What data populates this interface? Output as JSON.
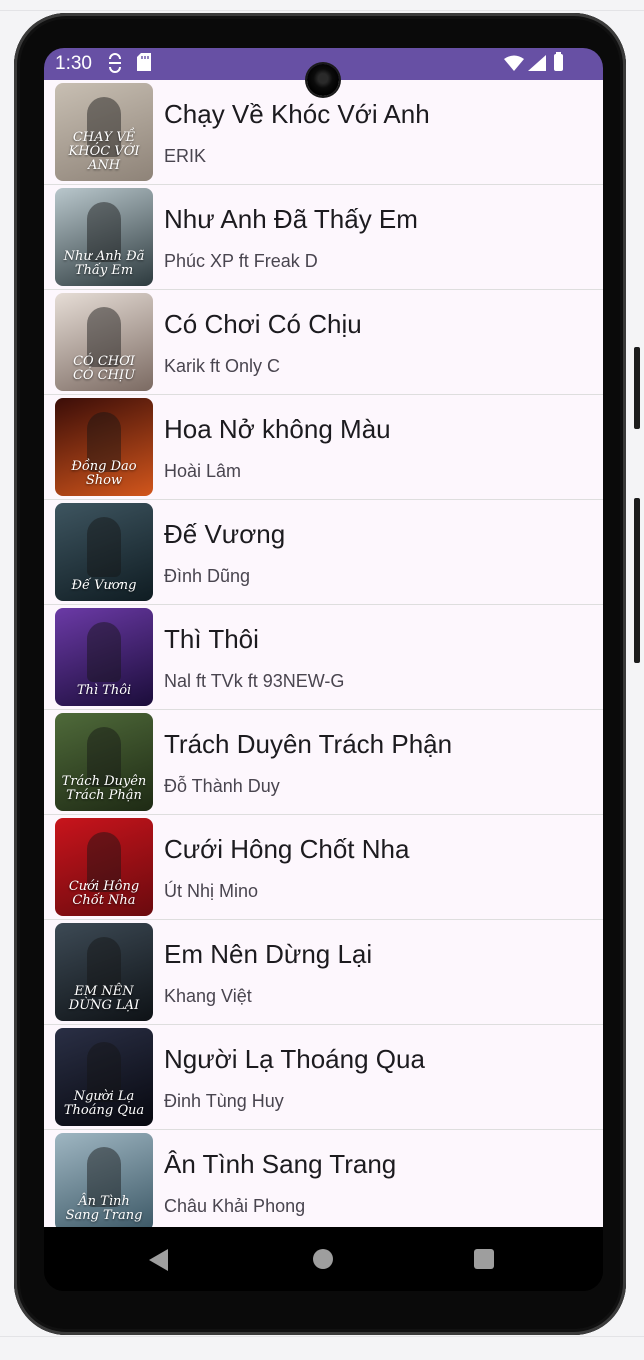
{
  "status_bar": {
    "time": "1:30",
    "icons": [
      "sync-icon",
      "sd-card-icon",
      "wifi-icon",
      "cell-signal-icon",
      "battery-icon"
    ]
  },
  "songs": [
    {
      "title": "Chạy Về Khóc Với Anh",
      "artist": "ERIK",
      "art_text": "CHẠY VỀ KHÓC VỚI ANH",
      "colors": [
        "#c8bfb3",
        "#8e8378"
      ]
    },
    {
      "title": "Như Anh Đã Thấy Em",
      "artist": "Phúc XP ft Freak D",
      "art_text": "Như Anh Đã Thấy Em",
      "colors": [
        "#b9c7cc",
        "#2d3a3e"
      ]
    },
    {
      "title": "Có Chơi Có Chịu",
      "artist": "Karik ft Only C",
      "art_text": "CÓ CHƠI CÓ CHỊU",
      "colors": [
        "#e6ddd6",
        "#7b6a62"
      ]
    },
    {
      "title": "Hoa Nở không Màu",
      "artist": "Hoài Lâm",
      "art_text": "Đồng Dao Show",
      "colors": [
        "#3b0d08",
        "#d2561c"
      ]
    },
    {
      "title": "Đế Vương",
      "artist": "Đình Dũng",
      "art_text": "Đế Vương",
      "colors": [
        "#3e5560",
        "#0f1c22"
      ]
    },
    {
      "title": "Thì Thôi",
      "artist": "Nal ft TVk ft 93NEW-G",
      "art_text": "Thì Thôi",
      "colors": [
        "#6b3aa6",
        "#1b0d3a"
      ]
    },
    {
      "title": "Trách Duyên Trách Phận",
      "artist": "Đỗ Thành Duy",
      "art_text": "Trách Duyên Trách Phận",
      "colors": [
        "#4f6a3a",
        "#1e2a14"
      ]
    },
    {
      "title": "Cưới Hông Chốt Nha",
      "artist": "Út Nhị Mino",
      "art_text": "Cưới Hông Chốt Nha",
      "colors": [
        "#c8141c",
        "#6a0a0e"
      ]
    },
    {
      "title": "Em Nên Dừng Lại",
      "artist": "Khang Việt",
      "art_text": "EM NÊN DỪNG LẠI",
      "colors": [
        "#3d4a55",
        "#0e1216"
      ]
    },
    {
      "title": "Người Lạ Thoáng Qua",
      "artist": "Đinh Tùng Huy",
      "art_text": "Người Lạ Thoáng Qua",
      "colors": [
        "#2a2f45",
        "#07080f"
      ]
    },
    {
      "title": "Ân Tình Sang Trang",
      "artist": "Châu Khải Phong",
      "art_text": "Ân Tình Sang Trang",
      "colors": [
        "#9fb6c2",
        "#3c5866"
      ]
    }
  ],
  "nav_bar": {
    "icons": [
      "back-icon",
      "home-icon",
      "recents-icon"
    ]
  }
}
